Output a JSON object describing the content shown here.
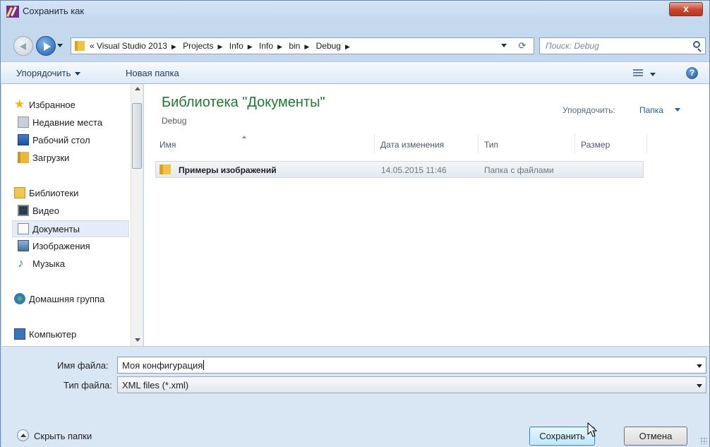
{
  "window": {
    "title": "Сохранить как",
    "close_label": "x"
  },
  "address": {
    "crumbs": [
      "« Visual Studio 2013",
      "Projects",
      "Info",
      "Info",
      "bin",
      "Debug"
    ],
    "search_placeholder": "Поиск: Debug"
  },
  "toolbar": {
    "organize_label": "Упорядочить",
    "new_folder_label": "Новая папка"
  },
  "nav": {
    "favorites": {
      "label": "Избранное",
      "items": [
        {
          "label": "Недавние места"
        },
        {
          "label": "Рабочий стол"
        },
        {
          "label": "Загрузки"
        }
      ]
    },
    "libraries": {
      "label": "Библиотеки",
      "items": [
        {
          "label": "Видео"
        },
        {
          "label": "Документы",
          "selected": true
        },
        {
          "label": "Изображения"
        },
        {
          "label": "Музыка"
        }
      ]
    },
    "homegroup_label": "Домашняя группа",
    "computer_label": "Компьютер"
  },
  "main": {
    "library_title": "Библиотека \"Документы\"",
    "library_subtitle": "Debug",
    "arrange_label": "Упорядочить:",
    "arrange_value": "Папка",
    "columns": [
      "Имя",
      "Дата изменения",
      "Тип",
      "Размер"
    ],
    "rows": [
      {
        "name": "Примеры изображений",
        "date": "14.05.2015 11:46",
        "type": "Папка с файлами",
        "size": ""
      }
    ]
  },
  "form": {
    "filename_label": "Имя файла:",
    "filename_value": "Моя конфигурация",
    "filetype_label": "Тип файла:",
    "filetype_value": "XML files (*.xml)",
    "hide_folders_label": "Скрыть папки",
    "save_label": "Сохранить",
    "cancel_label": "Отмена"
  }
}
